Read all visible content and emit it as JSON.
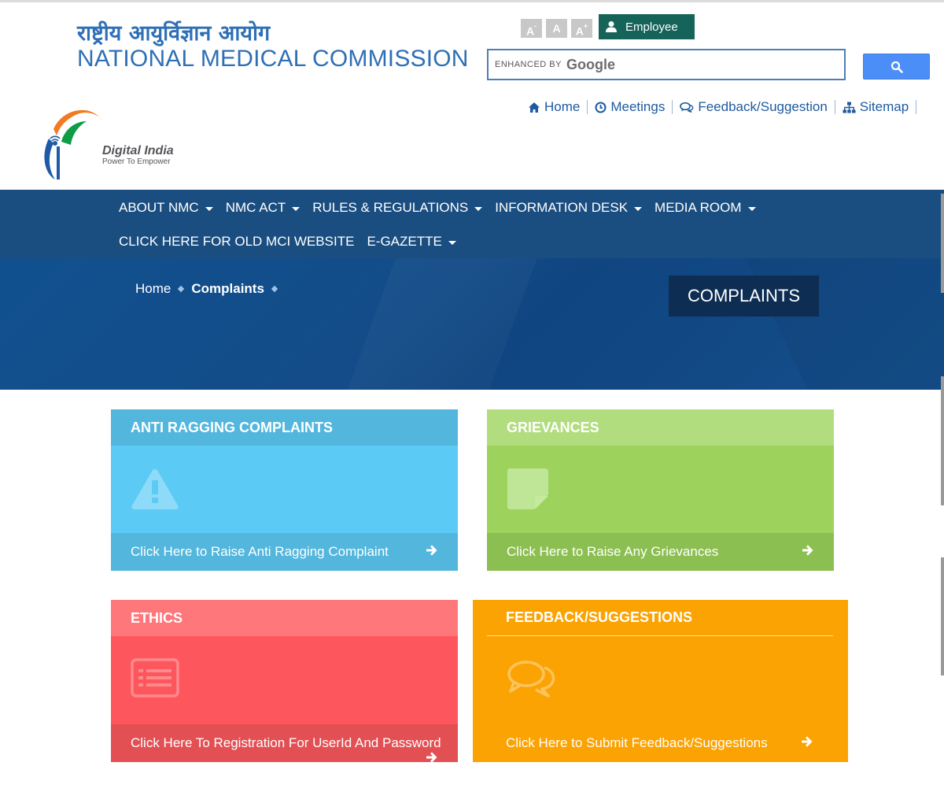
{
  "header": {
    "title_hindi": "राष्ट्रीय आयुर्विज्ञान आयोग",
    "title_english": "NATIONAL MEDICAL COMMISSION",
    "font_controls": {
      "decrease": "A",
      "decrease_sup": "-",
      "normal": "A",
      "increase": "A",
      "increase_sup": "+"
    },
    "employee_label": "Employee",
    "search": {
      "enhanced_by": "ENHANCED BY",
      "brand": "Google"
    },
    "top_links": [
      {
        "label": "Home",
        "icon": "home-icon"
      },
      {
        "label": "Meetings",
        "icon": "clock-icon"
      },
      {
        "label": "Feedback/Suggestion",
        "icon": "comments-icon"
      },
      {
        "label": "Sitemap",
        "icon": "sitemap-icon"
      }
    ],
    "digital_india": {
      "title": "Digital India",
      "tagline": "Power To Empower"
    }
  },
  "nav": {
    "row1": [
      {
        "label": "ABOUT NMC",
        "dropdown": true
      },
      {
        "label": "NMC ACT",
        "dropdown": true
      },
      {
        "label": "RULES & REGULATIONS",
        "dropdown": true
      },
      {
        "label": "INFORMATION DESK",
        "dropdown": true
      },
      {
        "label": "MEDIA ROOM",
        "dropdown": true
      }
    ],
    "row2": [
      {
        "label": "CLICK HERE FOR OLD MCI WEBSITE",
        "dropdown": false
      },
      {
        "label": "E-GAZETTE",
        "dropdown": true
      }
    ]
  },
  "banner": {
    "breadcrumb": {
      "home": "Home",
      "current": "Complaints"
    },
    "page_title": "COMPLAINTS"
  },
  "cards": {
    "anti_ragging": {
      "title": "ANTI RAGGING COMPLAINTS",
      "link": "Click Here to Raise Anti Ragging Complaint",
      "icon": "warning-icon",
      "color": "#5bcbf5"
    },
    "grievances": {
      "title": "GRIEVANCES",
      "link": "Click Here to Raise Any Grievances",
      "icon": "note-icon",
      "color": "#9dd35c"
    },
    "ethics": {
      "title": "ETHICS",
      "link": "Click Here To Registration For UserId And Password",
      "icon": "list-icon",
      "color": "#fd575d"
    },
    "feedback": {
      "title": "FEEDBACK/SUGGESTIONS",
      "link": "Click Here to Submit Feedback/Suggestions",
      "icon": "chat-icon",
      "color": "#fba302"
    }
  }
}
